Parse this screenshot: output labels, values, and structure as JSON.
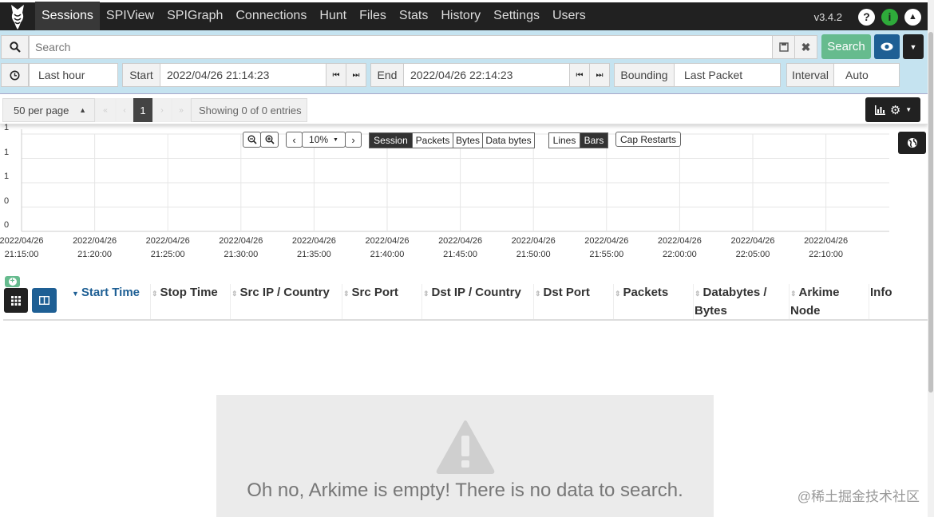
{
  "nav": {
    "items": [
      "Sessions",
      "SPIView",
      "SPIGraph",
      "Connections",
      "Hunt",
      "Files",
      "Stats",
      "History",
      "Settings",
      "Users"
    ],
    "active": "Sessions",
    "version": "v3.4.2"
  },
  "search": {
    "placeholder": "Search",
    "button_label": "Search"
  },
  "time": {
    "range_label": "Last hour",
    "start_label": "Start",
    "start_value": "2022/04/26 21:14:23",
    "end_label": "End",
    "end_value": "2022/04/26 22:14:23",
    "bounding_label": "Bounding",
    "bounding_value": "Last Packet",
    "interval_label": "Interval",
    "interval_value": "Auto"
  },
  "paging": {
    "per_page": "50 per page",
    "current_page": "1",
    "summary": "Showing 0 of 0 entries"
  },
  "graph_controls": {
    "zoom_value": "10%",
    "types": [
      "Session",
      "Packets",
      "Bytes",
      "Data bytes"
    ],
    "active_type": "Session",
    "styles": [
      "Lines",
      "Bars"
    ],
    "active_style": "Bars",
    "cap_restarts": "Cap Restarts"
  },
  "chart_data": {
    "type": "bar",
    "x": [
      "2022/04/26 21:15:00",
      "2022/04/26 21:20:00",
      "2022/04/26 21:25:00",
      "2022/04/26 21:30:00",
      "2022/04/26 21:35:00",
      "2022/04/26 21:40:00",
      "2022/04/26 21:45:00",
      "2022/04/26 21:50:00",
      "2022/04/26 21:55:00",
      "2022/04/26 22:00:00",
      "2022/04/26 22:05:00",
      "2022/04/26 22:10:00"
    ],
    "x_date": "2022/04/26",
    "x_times": [
      "21:15:00",
      "21:20:00",
      "21:25:00",
      "21:30:00",
      "21:35:00",
      "21:40:00",
      "21:45:00",
      "21:50:00",
      "21:55:00",
      "22:00:00",
      "22:05:00",
      "22:10:00"
    ],
    "y_ticks": [
      "1",
      "1",
      "1",
      "0",
      "0"
    ],
    "values": [
      0,
      0,
      0,
      0,
      0,
      0,
      0,
      0,
      0,
      0,
      0,
      0
    ],
    "grid": true
  },
  "table": {
    "columns": [
      {
        "label": "Start Time",
        "sorted": true
      },
      {
        "label": "Stop Time"
      },
      {
        "label": "Src IP / Country"
      },
      {
        "label": "Src Port"
      },
      {
        "label": "Dst IP / Country"
      },
      {
        "label": "Dst Port"
      },
      {
        "label": "Packets"
      },
      {
        "label": "Databytes / Bytes"
      },
      {
        "label": "Arkime Node"
      },
      {
        "label": "Info"
      }
    ]
  },
  "empty_message": "Oh no, Arkime is empty! There is no data to search.",
  "watermark": "@稀土掘金技术社区",
  "colors": {
    "nav_bg": "#212121",
    "band_bg": "#c5e3f0",
    "search_green": "#66bb8e",
    "accent_blue": "#1e5f94"
  }
}
